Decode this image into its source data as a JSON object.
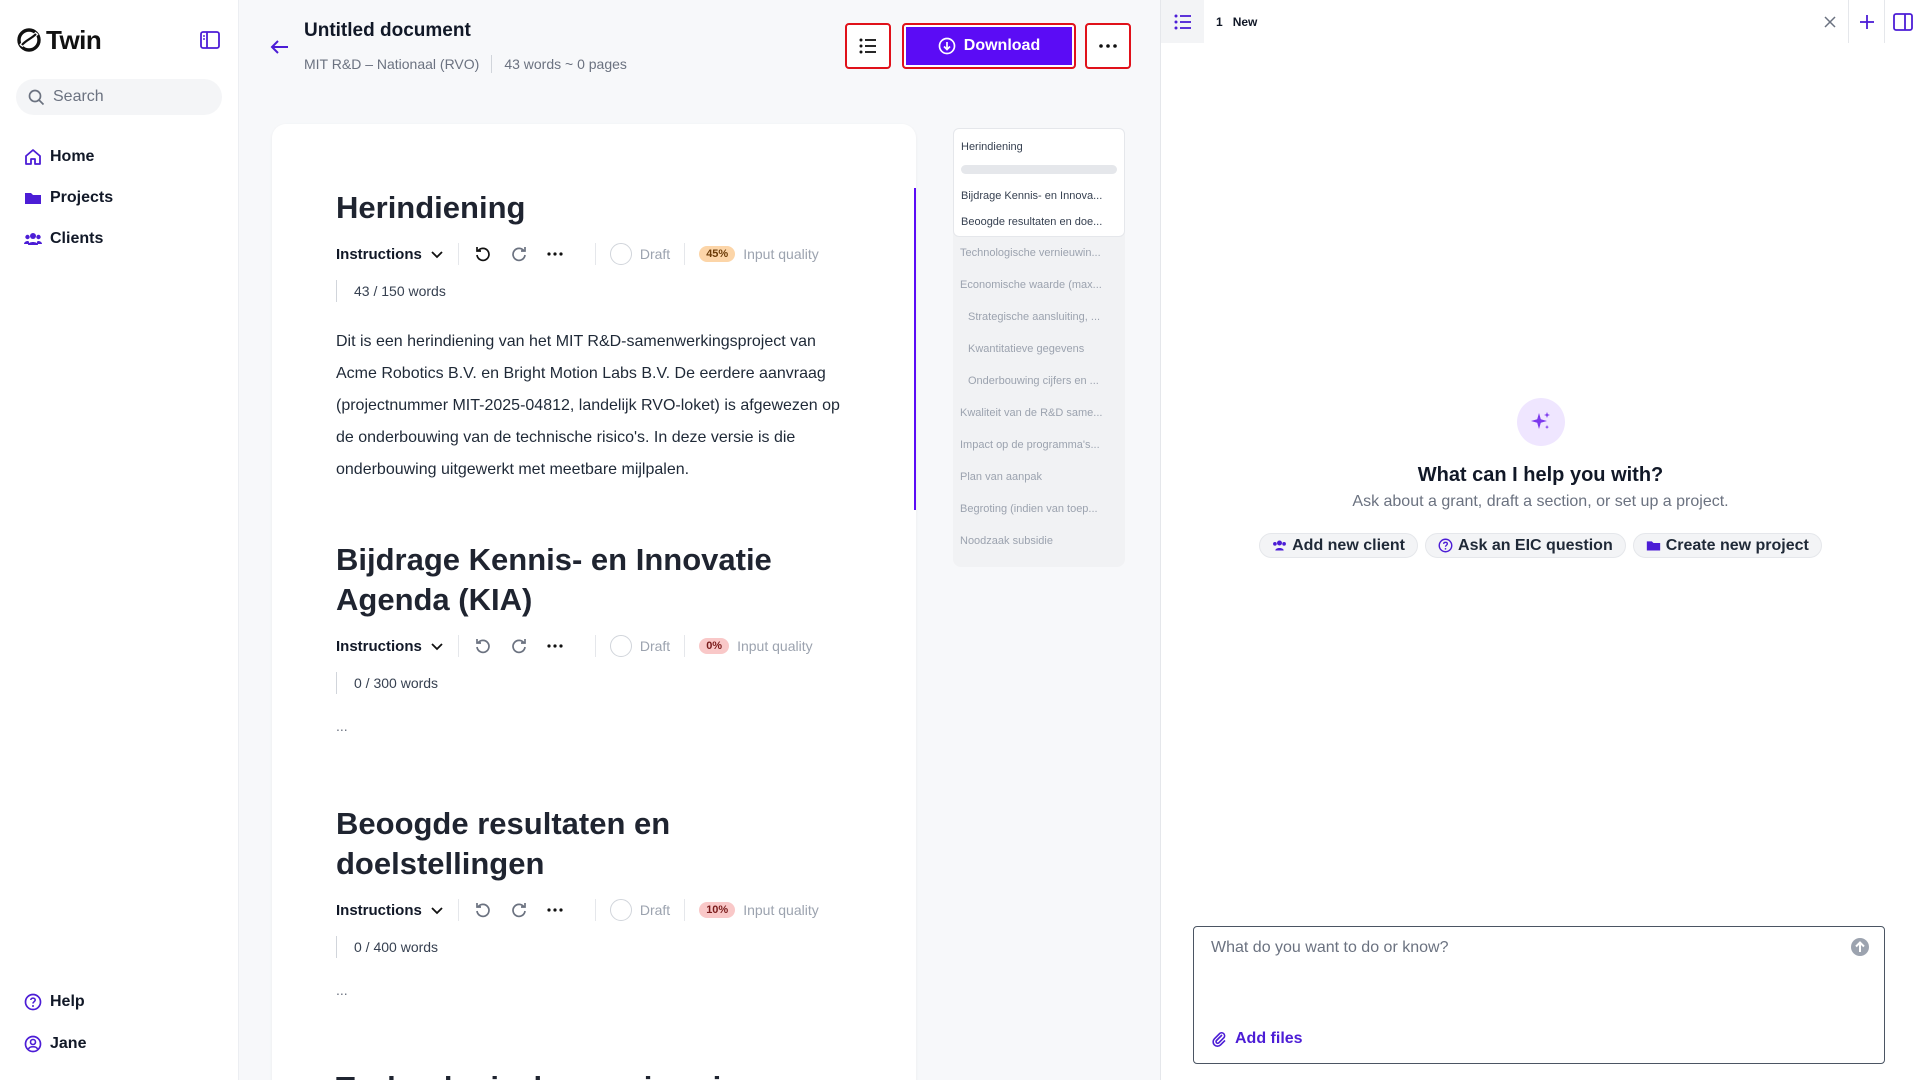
{
  "app": {
    "brand": "Twin"
  },
  "sidebar": {
    "search_placeholder": "Search",
    "nav": [
      {
        "label": "Home",
        "icon": "home-icon"
      },
      {
        "label": "Projects",
        "icon": "folder-icon"
      },
      {
        "label": "Clients",
        "icon": "users-icon"
      }
    ],
    "bottom": [
      {
        "label": "Help",
        "icon": "help-icon"
      },
      {
        "label": "Jane",
        "icon": "user-icon"
      }
    ]
  },
  "document": {
    "title": "Untitled document",
    "program": "MIT R&D – Nationaal (RVO)",
    "stats": "43 words ~ 0 pages",
    "download_label": "Download",
    "sections": [
      {
        "heading": "Herindiening",
        "instructions_label": "Instructions",
        "status": "Draft",
        "quality_badge": "45%",
        "quality_label": "Input quality",
        "word_count": "43 / 150 words",
        "body": "Dit is een herindiening van het MIT R&D-samenwerkingsproject van Acme Robotics B.V. en Bright Motion Labs B.V. De eerdere aanvraag (projectnummer MIT-2025-04812, landelijk RVO-loket) is afgewezen op de onderbouwing van de technische risico's. In deze versie is die onderbouwing uitgewerkt met meetbare mijlpalen."
      },
      {
        "heading": "Bijdrage Kennis- en Innovatie Agenda (KIA)",
        "instructions_label": "Instructions",
        "status": "Draft",
        "quality_badge": "0%",
        "quality_label": "Input quality",
        "word_count": "0 / 300 words",
        "body": "..."
      },
      {
        "heading": "Beoogde resultaten en doelstellingen",
        "instructions_label": "Instructions",
        "status": "Draft",
        "quality_badge": "10%",
        "quality_label": "Input quality",
        "word_count": "0 / 400 words",
        "body": "..."
      }
    ],
    "next_heading_partial": "Technologische vernieuwing"
  },
  "toc": {
    "active": [
      "Herindiening",
      "Bijdrage Kennis- en Innova...",
      "Beoogde resultaten en doe..."
    ],
    "items": [
      {
        "label": "Technologische vernieuwin...",
        "sub": false
      },
      {
        "label": "Economische waarde (max...",
        "sub": false
      },
      {
        "label": "Strategische aansluiting, ...",
        "sub": true
      },
      {
        "label": "Kwantitatieve gegevens",
        "sub": true
      },
      {
        "label": "Onderbouwing cijfers en ...",
        "sub": true
      },
      {
        "label": "Kwaliteit van de R&D same...",
        "sub": false
      },
      {
        "label": "Impact op de programma's...",
        "sub": false
      },
      {
        "label": "Plan van aanpak",
        "sub": false
      },
      {
        "label": "Begroting (indien van toep...",
        "sub": false
      },
      {
        "label": "Noodzaak subsidie",
        "sub": false
      }
    ]
  },
  "chat": {
    "tab_number": "1",
    "tab_label": "New",
    "title": "What can I help you with?",
    "subtitle": "Ask about a grant, draft a section, or set up a project.",
    "chips": [
      "Add new client",
      "Ask an EIC question",
      "Create new project"
    ],
    "input_placeholder": "What do you want to do or know?",
    "add_files_label": "Add files"
  },
  "colors": {
    "accent": "#5b0cf5",
    "highlight_border": "#e0111a"
  }
}
